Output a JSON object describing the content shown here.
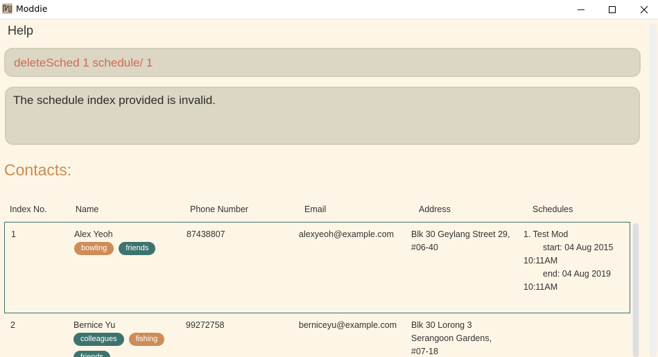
{
  "window": {
    "title": "Moddie"
  },
  "menu": {
    "help": "Help"
  },
  "command": {
    "value": "deleteSched 1 schedule/ 1"
  },
  "result": {
    "message": "The schedule index provided is invalid."
  },
  "contacts": {
    "title": "Contacts:",
    "headers": {
      "index": "Index No.",
      "name": "Name",
      "phone": "Phone Number",
      "email": "Email",
      "address": "Address",
      "schedules": "Schedules"
    },
    "rows": [
      {
        "index": "1",
        "name": "Alex Yeoh",
        "tags": [
          "bowling",
          "friends"
        ],
        "phone": "87438807",
        "email": "alexyeoh@example.com",
        "address_line1": "Blk 30 Geylang Street 29,",
        "address_line2": "#06-40",
        "sched_title": "1. Test Mod",
        "sched_start": "start: 04 Aug 2015",
        "sched_start_time": "10:11AM",
        "sched_end": "end: 04 Aug 2019",
        "sched_end_time": "10:11AM"
      },
      {
        "index": "2",
        "name": "Bernice Yu",
        "tags": [
          "colleagues",
          "fishing",
          "friends"
        ],
        "phone": "99272758",
        "email": "berniceyu@example.com",
        "address_line1": "Blk 30 Lorong 3",
        "address_line2": "Serangoon Gardens,",
        "address_line3": "#07-18"
      }
    ]
  },
  "colors": {
    "tag_green": "#3d736e",
    "tag_orange": "#cd8c58",
    "accent": "#c98c54",
    "command_text": "#cd6b57"
  }
}
